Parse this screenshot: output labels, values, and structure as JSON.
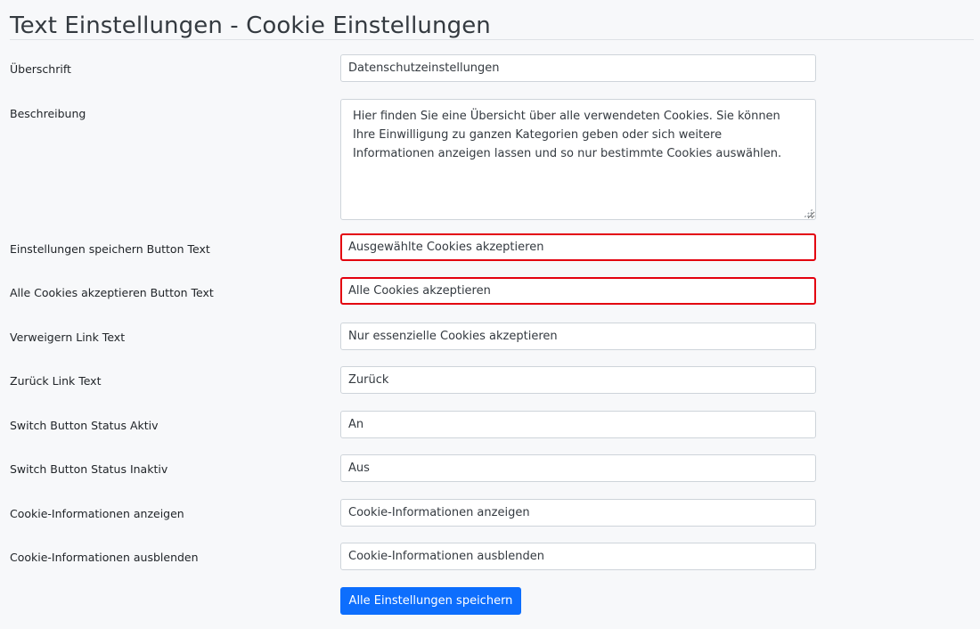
{
  "header": {
    "title": "Text Einstellungen - Cookie Einstellungen"
  },
  "form": {
    "heading_label": "Überschrift",
    "heading_value": "Datenschutzeinstellungen",
    "description_label": "Beschreibung",
    "description_value": "Hier finden Sie eine Übersicht über alle verwendeten Cookies. Sie können Ihre Einwilligung zu ganzen Kategorien geben oder sich weitere Informationen anzeigen lassen und so nur bestimmte Cookies auswählen.",
    "save_settings_button_label": "Einstellungen speichern Button Text",
    "save_settings_button_value": "Ausgewählte Cookies akzeptieren",
    "accept_all_button_label": "Alle Cookies akzeptieren Button Text",
    "accept_all_button_value": "Alle Cookies akzeptieren",
    "decline_link_label": "Verweigern Link Text",
    "decline_link_value": "Nur essenzielle Cookies akzeptieren",
    "back_link_label": "Zurück Link Text",
    "back_link_value": "Zurück",
    "switch_active_label": "Switch Button Status Aktiv",
    "switch_active_value": "An",
    "switch_inactive_label": "Switch Button Status Inaktiv",
    "switch_inactive_value": "Aus",
    "show_info_label": "Cookie-Informationen anzeigen",
    "show_info_value": "Cookie-Informationen anzeigen",
    "hide_info_label": "Cookie-Informationen ausblenden",
    "hide_info_value": "Cookie-Informationen ausblenden",
    "submit_label": "Alle Einstellungen speichern"
  },
  "colors": {
    "highlight_border": "#e3000f",
    "primary_button": "#0d6efd"
  }
}
